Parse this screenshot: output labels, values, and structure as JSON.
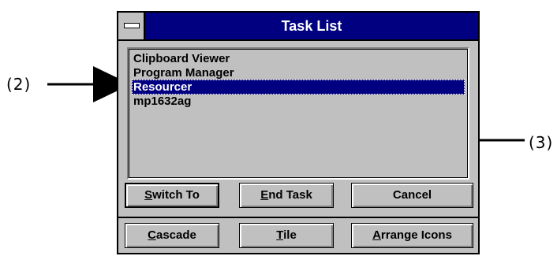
{
  "callouts": {
    "label_2": "(2)",
    "label_3": "(3)"
  },
  "window": {
    "title": "Task List",
    "system_menu_icon": "minus-bar-icon",
    "tasks": [
      "Clipboard Viewer",
      "Program Manager",
      "Resourcer",
      "mp1632ag"
    ],
    "selected_task": "Resourcer"
  },
  "buttons": {
    "switch_to": {
      "mnemonic": "S",
      "rest": "witch To"
    },
    "end_task": {
      "mnemonic": "E",
      "rest": "nd Task"
    },
    "cancel": "Cancel",
    "cascade": {
      "mnemonic": "C",
      "rest": "ascade"
    },
    "tile": {
      "mnemonic": "T",
      "rest": "ile"
    },
    "arrange_icons": {
      "mnemonic": "A",
      "rest": "rrange Icons"
    }
  },
  "colors": {
    "title_bar": "#000080",
    "selection": "#000080",
    "face": "#c0c0c0"
  }
}
